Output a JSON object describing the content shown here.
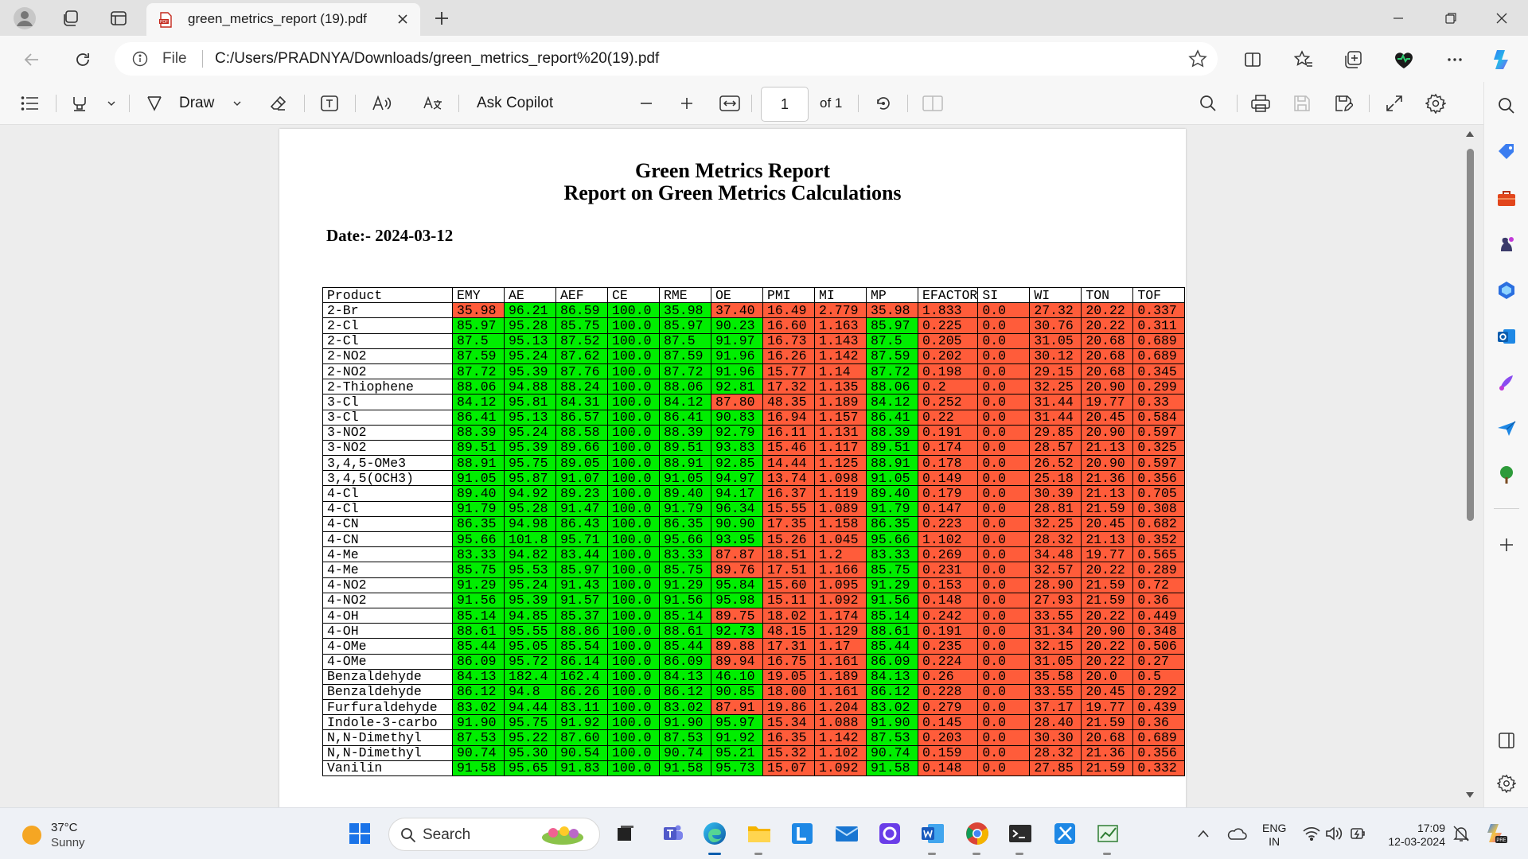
{
  "browser": {
    "tab_title": "green_metrics_report (19).pdf",
    "address_label": "File",
    "url": "C:/Users/PRADNYA/Downloads/green_metrics_report%20(19).pdf"
  },
  "pdf_toolbar": {
    "draw_label": "Draw",
    "ask_copilot_label": "Ask Copilot",
    "page_current": "1",
    "page_total": "of 1"
  },
  "report": {
    "title": "Green Metrics Report",
    "subtitle": "Report on Green Metrics Calculations",
    "date_line": "Date:- 2024-03-12",
    "columns": [
      "Product",
      "EMY",
      "AE",
      "AEF",
      "CE",
      "RME",
      "OE",
      "PMI",
      "MI",
      "MP",
      "EFACTOR",
      "SI",
      "WI",
      "TON",
      "TOF"
    ],
    "rows": [
      [
        "2-Br",
        "35.98",
        "96.21",
        "86.59",
        "100.0",
        "35.98",
        "37.40",
        "16.49",
        "2.779",
        "35.98",
        "1.833",
        "0.0",
        "27.32",
        "20.22",
        "0.337"
      ],
      [
        "2-Cl",
        "85.97",
        "95.28",
        "85.75",
        "100.0",
        "85.97",
        "90.23",
        "16.60",
        "1.163",
        "85.97",
        "0.225",
        "0.0",
        "30.76",
        "20.22",
        "0.311"
      ],
      [
        "2-Cl",
        "87.5",
        "95.13",
        "87.52",
        "100.0",
        "87.5",
        "91.97",
        "16.73",
        "1.143",
        "87.5",
        "0.205",
        "0.0",
        "31.05",
        "20.68",
        "0.689"
      ],
      [
        "2-NO2",
        "87.59",
        "95.24",
        "87.62",
        "100.0",
        "87.59",
        "91.96",
        "16.26",
        "1.142",
        "87.59",
        "0.202",
        "0.0",
        "30.12",
        "20.68",
        "0.689"
      ],
      [
        "2-NO2",
        "87.72",
        "95.39",
        "87.76",
        "100.0",
        "87.72",
        "91.96",
        "15.77",
        "1.14",
        "87.72",
        "0.198",
        "0.0",
        "29.15",
        "20.68",
        "0.345"
      ],
      [
        "2-Thiophene",
        "88.06",
        "94.88",
        "88.24",
        "100.0",
        "88.06",
        "92.81",
        "17.32",
        "1.135",
        "88.06",
        "0.2",
        "0.0",
        "32.25",
        "20.90",
        "0.299"
      ],
      [
        "3-Cl",
        "84.12",
        "95.81",
        "84.31",
        "100.0",
        "84.12",
        "87.80",
        "48.35",
        "1.189",
        "84.12",
        "0.252",
        "0.0",
        "31.44",
        "19.77",
        "0.33"
      ],
      [
        "3-Cl",
        "86.41",
        "95.13",
        "86.57",
        "100.0",
        "86.41",
        "90.83",
        "16.94",
        "1.157",
        "86.41",
        "0.22",
        "0.0",
        "31.44",
        "20.45",
        "0.584"
      ],
      [
        "3-NO2",
        "88.39",
        "95.24",
        "88.58",
        "100.0",
        "88.39",
        "92.79",
        "16.11",
        "1.131",
        "88.39",
        "0.191",
        "0.0",
        "29.85",
        "20.90",
        "0.597"
      ],
      [
        "3-NO2",
        "89.51",
        "95.39",
        "89.66",
        "100.0",
        "89.51",
        "93.83",
        "15.46",
        "1.117",
        "89.51",
        "0.174",
        "0.0",
        "28.57",
        "21.13",
        "0.325"
      ],
      [
        "3,4,5-OMe3",
        "88.91",
        "95.75",
        "89.05",
        "100.0",
        "88.91",
        "92.85",
        "14.44",
        "1.125",
        "88.91",
        "0.178",
        "0.0",
        "26.52",
        "20.90",
        "0.597"
      ],
      [
        "3,4,5(OCH3)",
        "91.05",
        "95.87",
        "91.07",
        "100.0",
        "91.05",
        "94.97",
        "13.74",
        "1.098",
        "91.05",
        "0.149",
        "0.0",
        "25.18",
        "21.36",
        "0.356"
      ],
      [
        "4-Cl",
        "89.40",
        "94.92",
        "89.23",
        "100.0",
        "89.40",
        "94.17",
        "16.37",
        "1.119",
        "89.40",
        "0.179",
        "0.0",
        "30.39",
        "21.13",
        "0.705"
      ],
      [
        "4-Cl",
        "91.79",
        "95.28",
        "91.47",
        "100.0",
        "91.79",
        "96.34",
        "15.55",
        "1.089",
        "91.79",
        "0.147",
        "0.0",
        "28.81",
        "21.59",
        "0.308"
      ],
      [
        "4-CN",
        "86.35",
        "94.98",
        "86.43",
        "100.0",
        "86.35",
        "90.90",
        "17.35",
        "1.158",
        "86.35",
        "0.223",
        "0.0",
        "32.25",
        "20.45",
        "0.682"
      ],
      [
        "4-CN",
        "95.66",
        "101.8",
        "95.71",
        "100.0",
        "95.66",
        "93.95",
        "15.26",
        "1.045",
        "95.66",
        "1.102",
        "0.0",
        "28.32",
        "21.13",
        "0.352"
      ],
      [
        "4-Me",
        "83.33",
        "94.82",
        "83.44",
        "100.0",
        "83.33",
        "87.87",
        "18.51",
        "1.2",
        "83.33",
        "0.269",
        "0.0",
        "34.48",
        "19.77",
        "0.565"
      ],
      [
        "4-Me",
        "85.75",
        "95.53",
        "85.97",
        "100.0",
        "85.75",
        "89.76",
        "17.51",
        "1.166",
        "85.75",
        "0.231",
        "0.0",
        "32.57",
        "20.22",
        "0.289"
      ],
      [
        "4-NO2",
        "91.29",
        "95.24",
        "91.43",
        "100.0",
        "91.29",
        "95.84",
        "15.60",
        "1.095",
        "91.29",
        "0.153",
        "0.0",
        "28.90",
        "21.59",
        "0.72"
      ],
      [
        "4-NO2",
        "91.56",
        "95.39",
        "91.57",
        "100.0",
        "91.56",
        "95.98",
        "15.11",
        "1.092",
        "91.56",
        "0.148",
        "0.0",
        "27.93",
        "21.59",
        "0.36"
      ],
      [
        "4-OH",
        "85.14",
        "94.85",
        "85.37",
        "100.0",
        "85.14",
        "89.75",
        "18.02",
        "1.174",
        "85.14",
        "0.242",
        "0.0",
        "33.55",
        "20.22",
        "0.449"
      ],
      [
        "4-OH",
        "88.61",
        "95.55",
        "88.86",
        "100.0",
        "88.61",
        "92.73",
        "48.15",
        "1.129",
        "88.61",
        "0.191",
        "0.0",
        "31.34",
        "20.90",
        "0.348"
      ],
      [
        "4-OMe",
        "85.44",
        "95.05",
        "85.54",
        "100.0",
        "85.44",
        "89.88",
        "17.31",
        "1.17",
        "85.44",
        "0.235",
        "0.0",
        "32.15",
        "20.22",
        "0.506"
      ],
      [
        "4-OMe",
        "86.09",
        "95.72",
        "86.14",
        "100.0",
        "86.09",
        "89.94",
        "16.75",
        "1.161",
        "86.09",
        "0.224",
        "0.0",
        "31.05",
        "20.22",
        "0.27"
      ],
      [
        "Benzaldehyde",
        "84.13",
        "182.4",
        "162.4",
        "100.0",
        "84.13",
        "46.10",
        "19.05",
        "1.189",
        "84.13",
        "0.26",
        "0.0",
        "35.58",
        "20.0",
        "0.5"
      ],
      [
        "Benzaldehyde",
        "86.12",
        "94.8",
        "86.26",
        "100.0",
        "86.12",
        "90.85",
        "18.00",
        "1.161",
        "86.12",
        "0.228",
        "0.0",
        "33.55",
        "20.45",
        "0.292"
      ],
      [
        "Furfuraldehyde",
        "83.02",
        "94.44",
        "83.11",
        "100.0",
        "83.02",
        "87.91",
        "19.86",
        "1.204",
        "83.02",
        "0.279",
        "0.0",
        "37.17",
        "19.77",
        "0.439"
      ],
      [
        "Indole-3-carbo",
        "91.90",
        "95.75",
        "91.92",
        "100.0",
        "91.90",
        "95.97",
        "15.34",
        "1.088",
        "91.90",
        "0.145",
        "0.0",
        "28.40",
        "21.59",
        "0.36"
      ],
      [
        "N,N-Dimethyl",
        "87.53",
        "95.22",
        "87.60",
        "100.0",
        "87.53",
        "91.92",
        "16.35",
        "1.142",
        "87.53",
        "0.203",
        "0.0",
        "30.30",
        "20.68",
        "0.689"
      ],
      [
        "N,N-Dimethyl",
        "90.74",
        "95.30",
        "90.54",
        "100.0",
        "90.74",
        "95.21",
        "15.32",
        "1.102",
        "90.74",
        "0.159",
        "0.0",
        "28.32",
        "21.36",
        "0.356"
      ],
      [
        "Vanilin",
        "91.58",
        "95.65",
        "91.83",
        "100.0",
        "91.58",
        "95.73",
        "15.07",
        "1.092",
        "91.58",
        "0.148",
        "0.0",
        "27.85",
        "21.59",
        "0.332"
      ]
    ],
    "cell_colors": [
      "wrggggrrrrrrrrr",
      "wggggggrrgrrrrr",
      "wggggggrrgrrrrr",
      "wggggggrrgrrrrr",
      "wggggggrrgrrrrr",
      "wggggggrrgrrrrr",
      "wgggggrrrgrrrrr",
      "wggggggrrgrrrrr",
      "wggggggrrgrrrrr",
      "wggggggrrgrrrrr",
      "wggggggrrgrrrrr",
      "wggggggrrgrrrrr",
      "wggggggrrgrrrrr",
      "wggggggrrgrrrrr",
      "wggggggrrgrrrrr",
      "wggggggrrgrrrrr",
      "wgggggrrrgrrrrr",
      "wgggggrrrgrrrrr",
      "wggggggrrgrrrrr",
      "wggggggrrgrrrrr",
      "wgggggrrrgrrrrr",
      "wggggggrrgrrrrr",
      "wgggggrrrgrrrrr",
      "wgggggrrrgrrrrr",
      "wggggggrrgrrrrr",
      "wggggggrrgrrrrr",
      "wgggggrrrgrrrrr",
      "wggggggrrgrrrrr",
      "wggggggrrgrrrrr",
      "wggggggrrgrrrrr",
      "wggggggrrgrrrrr"
    ],
    "colors": {
      "good": "#00ee00",
      "bad": "#ff5c3a"
    }
  },
  "taskbar": {
    "weather_temp": "37°C",
    "weather_condition": "Sunny",
    "search_label": "Search",
    "lang_line1": "ENG",
    "lang_line2": "IN",
    "time": "17:09",
    "date": "12-03-2024"
  }
}
